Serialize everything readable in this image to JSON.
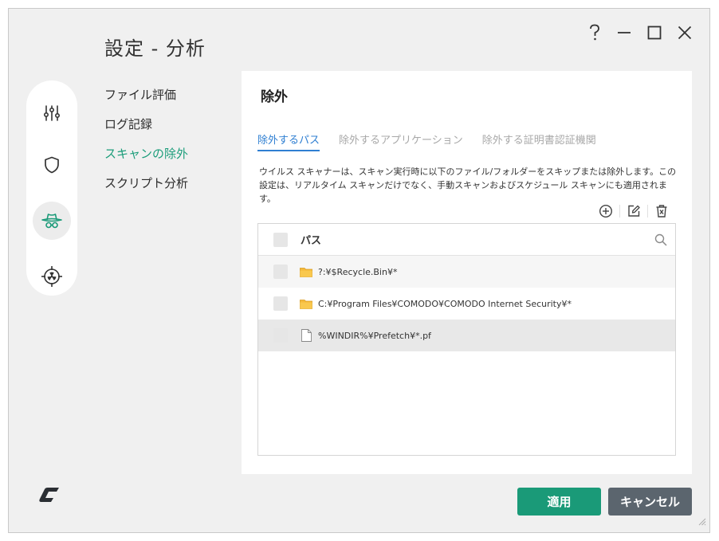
{
  "window": {
    "title": "設定 - 分析",
    "controls": [
      "help-icon",
      "minimize-icon",
      "maximize-icon",
      "close-icon"
    ]
  },
  "rail": {
    "items": [
      {
        "icon": "sliders-icon",
        "active": false
      },
      {
        "icon": "shield-icon",
        "active": false
      },
      {
        "icon": "spy-hat-icon",
        "active": true
      },
      {
        "icon": "crosshair-radiation-icon",
        "active": false
      }
    ]
  },
  "subnav": {
    "items": [
      {
        "label": "ファイル評価"
      },
      {
        "label": "ログ記録"
      },
      {
        "label": "スキャンの除外",
        "active": true
      },
      {
        "label": "スクリプト分析"
      }
    ]
  },
  "panel": {
    "title": "除外",
    "tabs": [
      {
        "label": "除外するパス",
        "active": true
      },
      {
        "label": "除外するアプリケーション"
      },
      {
        "label": "除外する証明書認証機関"
      }
    ],
    "description": "ウイルス スキャナーは、スキャン実行時に以下のファイル/フォルダーをスキップまたは除外します。この設定は、リアルタイム スキャンだけでなく、手動スキャンおよびスケジュール スキャンにも適用されます。",
    "toolbar": [
      "add-circle-icon",
      "edit-icon",
      "trash-icon"
    ],
    "table": {
      "column": "パス",
      "rows": [
        {
          "icon": "folder-icon",
          "path": "?:¥$Recycle.Bin¥*"
        },
        {
          "icon": "folder-icon",
          "path": "C:¥Program Files¥COMODO¥COMODO Internet Security¥*"
        },
        {
          "icon": "file-icon",
          "path": "%WINDIR%¥Prefetch¥*.pf"
        }
      ]
    }
  },
  "buttons": {
    "apply": "適用",
    "cancel": "キャンセル"
  },
  "colors": {
    "accent": "#1a9a78",
    "tab_active": "#2f7fd2",
    "cancel": "#5b656e",
    "folder": "#f5b93b"
  }
}
